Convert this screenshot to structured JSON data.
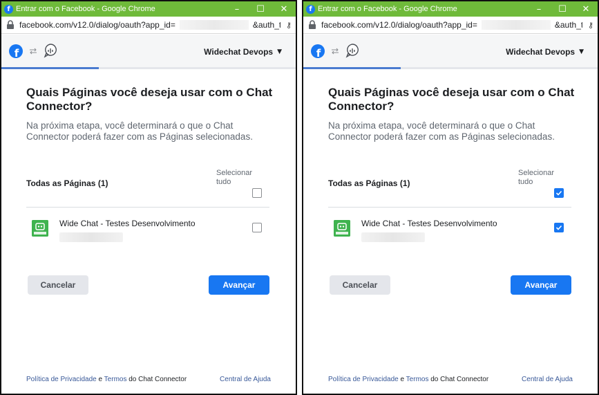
{
  "windows": [
    {
      "title": "Entrar com o Facebook - Google Chrome",
      "url_part1": "facebook.com/v12.0/dialog/oauth?app_id=",
      "url_part2": "&auth_type&cb...",
      "account_name": "Widechat Devops",
      "heading": "Quais Páginas você deseja usar com o Chat Connector?",
      "subtext": "Na próxima etapa, você determinará o que o Chat Connector poderá fazer com as Páginas selecionadas.",
      "select_all_label": "Selecionar tudo",
      "all_pages_label": "Todas as Páginas (1)",
      "select_all_checked": false,
      "page_name": "Wide Chat - Testes Desenvolvimento",
      "page_checked": false,
      "cancel_label": "Cancelar",
      "next_label": "Avançar",
      "footer_privacy": "Política de Privacidade",
      "footer_and": " e ",
      "footer_terms": "Termos",
      "footer_suffix": " do Chat Connector",
      "footer_help": "Central de Ajuda"
    },
    {
      "title": "Entrar com o Facebook - Google Chrome",
      "url_part1": "facebook.com/v12.0/dialog/oauth?app_id=",
      "url_part2": "&auth_type&cb...",
      "account_name": "Widechat Devops",
      "heading": "Quais Páginas você deseja usar com o Chat Connector?",
      "subtext": "Na próxima etapa, você determinará o que o Chat Connector poderá fazer com as Páginas selecionadas.",
      "select_all_label": "Selecionar tudo",
      "all_pages_label": "Todas as Páginas (1)",
      "select_all_checked": true,
      "page_name": "Wide Chat - Testes Desenvolvimento",
      "page_checked": true,
      "cancel_label": "Cancelar",
      "next_label": "Avançar",
      "footer_privacy": "Política de Privacidade",
      "footer_and": " e ",
      "footer_terms": "Termos",
      "footer_suffix": " do Chat Connector",
      "footer_help": "Central de Ajuda"
    }
  ],
  "colors": {
    "titlebar": "#6fba3a",
    "facebook_blue": "#1877f2",
    "cancel_bg": "#e4e6eb",
    "link": "#385898"
  },
  "icons": {
    "titlebar": "facebook-icon",
    "lock": "lock-icon",
    "key": "key-icon",
    "header_logo": "facebook-logo-icon",
    "swap": "swap-icon",
    "app": "chat-connector-icon",
    "caret": "caret-down-icon",
    "check": "checkmark-icon",
    "page": "page-avatar-icon"
  }
}
